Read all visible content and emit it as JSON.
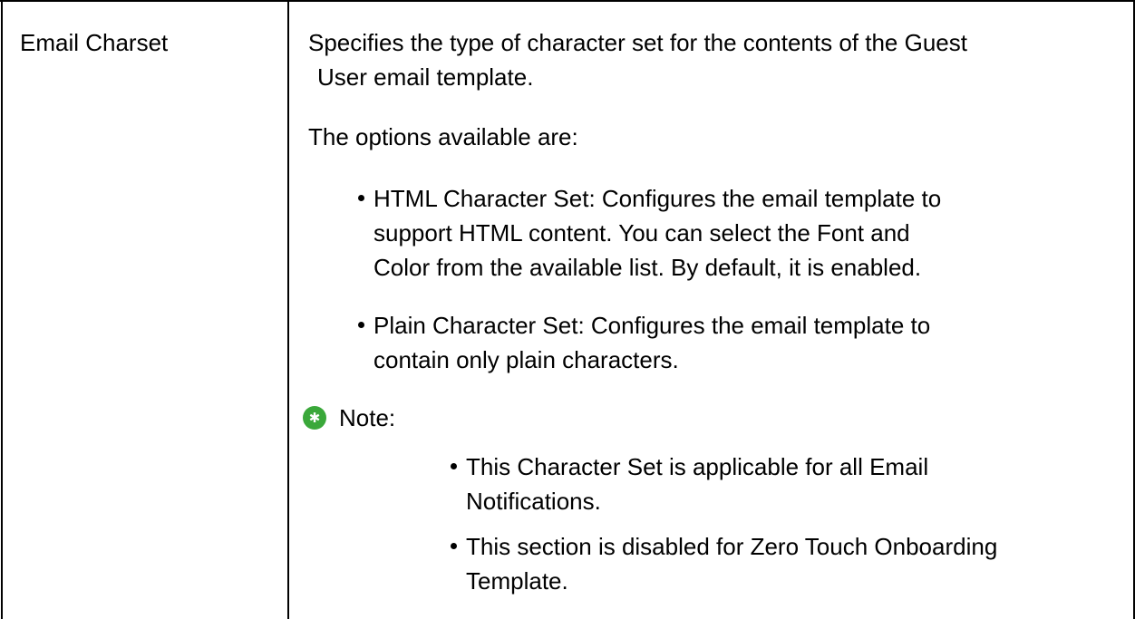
{
  "row": {
    "term": "Email Charset",
    "description_line1": "Specifies the type of character set for the contents of the Guest",
    "description_line2": "User email template.",
    "options_intro": "The options available are:",
    "options": [
      {
        "label": "HTML Character Set",
        "text_line1": ": Configures the email template to",
        "text_line2": "support HTML content. You can select the Font and",
        "text_line3": "Color from the available list. By default, it is enabled."
      },
      {
        "label": "Plain Character Set",
        "text_line1": ": Configures the email template to",
        "text_line2": "contain only plain characters."
      }
    ],
    "note": {
      "heading": "Note:",
      "icon": "green-star-note-icon",
      "icon_color": "#3aa83a",
      "items": [
        {
          "line1": "This Character Set is applicable for all Email",
          "line2": "Notifications."
        },
        {
          "line1": "This section is disabled for Zero Touch Onboarding",
          "line2": "Template."
        }
      ]
    }
  }
}
